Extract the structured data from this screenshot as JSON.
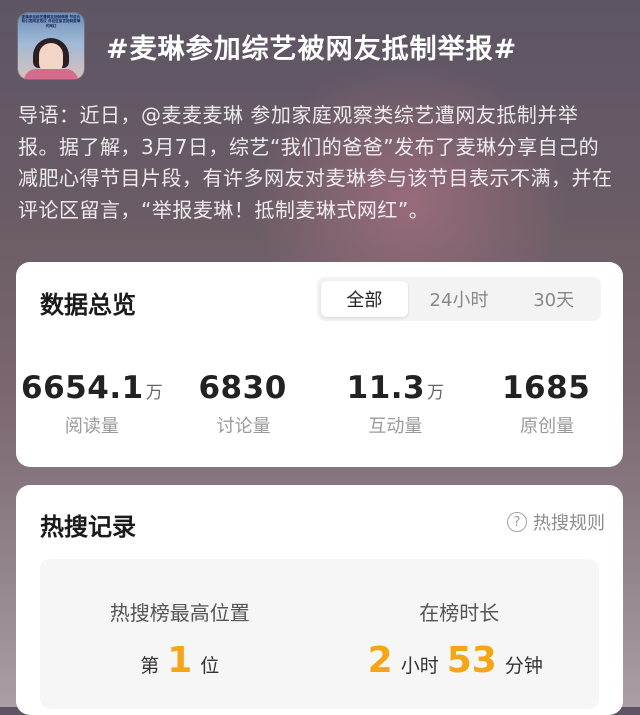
{
  "header": {
    "title": "#麦琳参加综艺被网友抵制举报#",
    "thumbnail_caption": "麦琳参加综艺遭网友抵制举报 节目片段引发网友热议 评论区留言抵制麦琳式网红"
  },
  "lead": "导语：近日，@麦麦麦琳 参加家庭观察类综艺遭网友抵制并举报。据了解，3月7日，综艺“我们的爸爸”发布了麦琳分享自己的减肥心得节目片段，有许多网友对麦琳参与该节目表示不满，并在评论区留言，“举报麦琳！抵制麦琳式网红”。",
  "overview": {
    "title": "数据总览",
    "tabs": [
      {
        "label": "全部",
        "active": true
      },
      {
        "label": "24小时",
        "active": false
      },
      {
        "label": "30天",
        "active": false
      }
    ],
    "stats": [
      {
        "value": "6654.1",
        "unit": "万",
        "label": "阅读量"
      },
      {
        "value": "6830",
        "unit": "",
        "label": "讨论量"
      },
      {
        "value": "11.3",
        "unit": "万",
        "label": "互动量"
      },
      {
        "value": "1685",
        "unit": "",
        "label": "原创量"
      }
    ]
  },
  "hot": {
    "title": "热搜记录",
    "rules_label": "热搜规则",
    "help_glyph": "?",
    "peak": {
      "label": "热搜榜最高位置",
      "prefix": "第",
      "value": "1",
      "suffix": "位"
    },
    "duration": {
      "label": "在榜时长",
      "hours": "2",
      "hours_unit": "小时",
      "minutes": "53",
      "minutes_unit": "分钟"
    }
  },
  "colors": {
    "accent_orange": "#f6a518",
    "card_bg": "#ffffff",
    "muted_text": "#9a9a9a"
  },
  "icons": [
    "question-circle-icon"
  ]
}
